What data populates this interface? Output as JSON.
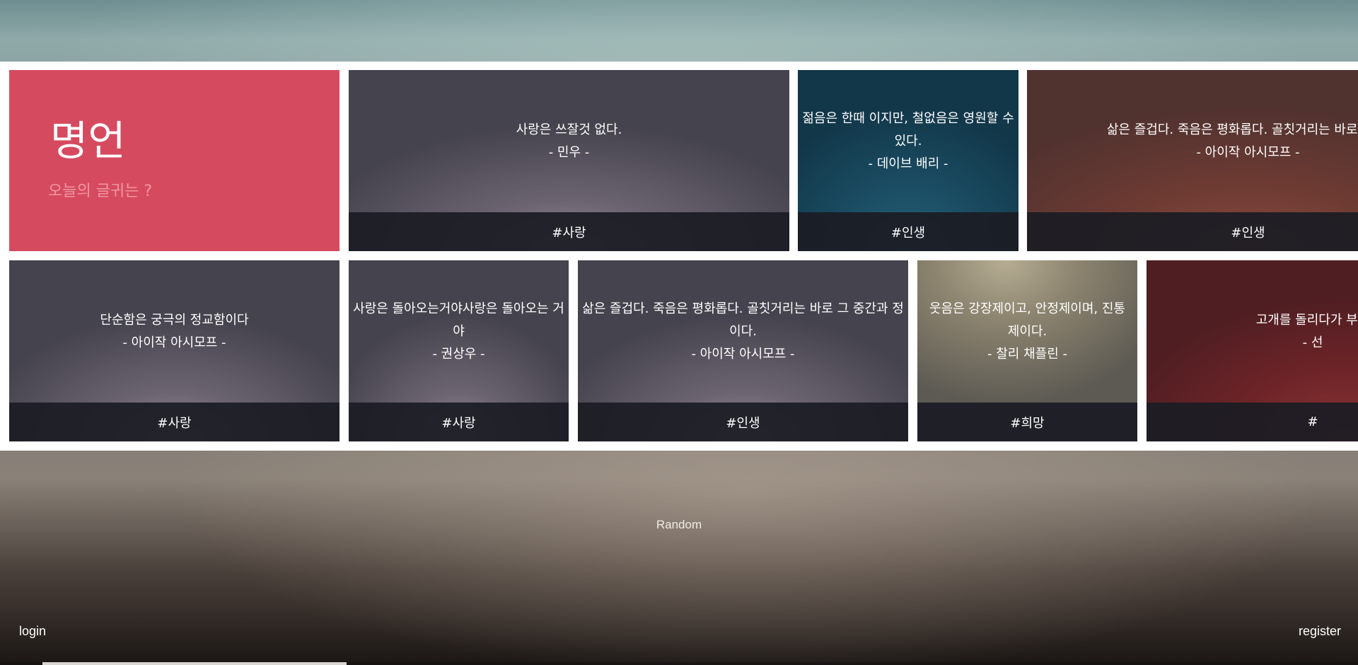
{
  "header": {
    "title": "명언",
    "subtitle": "오늘의 글귀는 ?"
  },
  "cards": [
    {
      "quote": "사랑은 쓰잘것 없다.",
      "author": "- 민우 -",
      "tag": "#사랑"
    },
    {
      "quote": "젊음은 한때 이지만, 철없음은 영원할 수 있다.",
      "author": "- 데이브 배리 -",
      "tag": "#인생"
    },
    {
      "quote": "삶은 즐겁다. 죽음은 평화롭다. 골칫거리는 바로 그 중",
      "author": "- 아이작 아시모프 -",
      "tag": "#인생"
    },
    {
      "quote": "단순함은 궁극의 정교함이다",
      "author": "- 아이작 아시모프 -",
      "tag": "#사랑"
    },
    {
      "quote": "사랑은 돌아오는거야사랑은 돌아오는 거야",
      "author": "- 권상우 -",
      "tag": "#사랑"
    },
    {
      "quote": "삶은 즐겁다. 죽음은 평화롭다. 골칫거리는 바로 그 중간과 정이다.",
      "author": "- 아이작 아시모프 -",
      "tag": "#인생"
    },
    {
      "quote": "웃음은 강장제이고, 안정제이며, 진통 제이다.",
      "author": "- 찰리 채플린 -",
      "tag": "#희망"
    },
    {
      "quote": "고개를 돌리다가 부딪",
      "author": "- 선",
      "tag": "#"
    }
  ],
  "nav": {
    "random_label": "Random",
    "login_label": "login",
    "register_label": "register"
  }
}
